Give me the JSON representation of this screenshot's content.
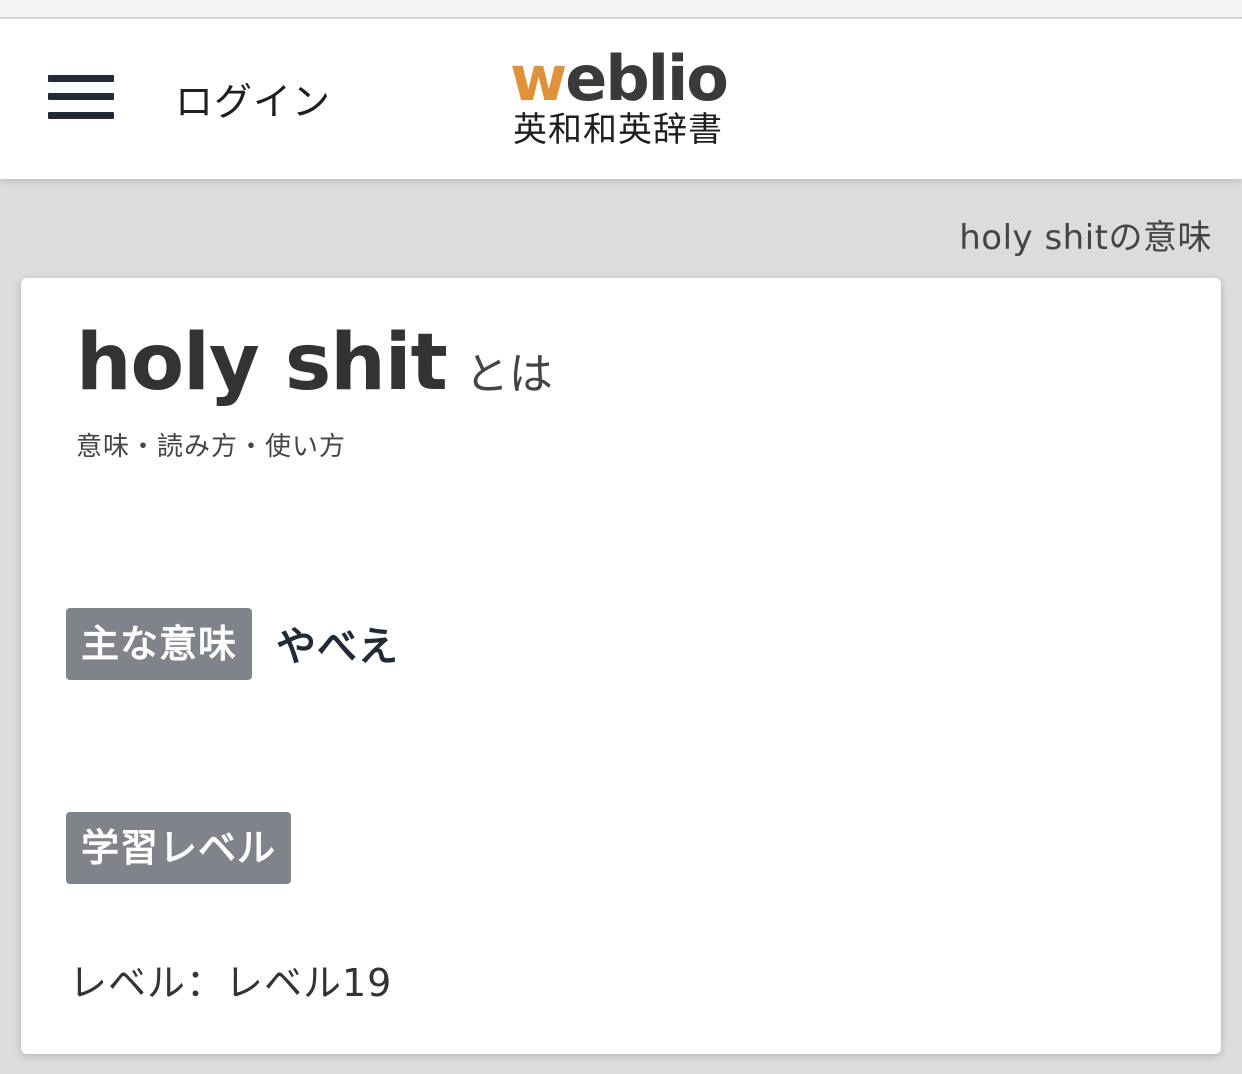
{
  "header": {
    "menu_icon": "hamburger-menu-icon",
    "login_label": "ログイン",
    "logo": {
      "word_first": "w",
      "word_rest": "eblio",
      "subtitle": "英和和英辞書",
      "accent_color": "#e0923a"
    }
  },
  "breadcrumb": "holy shitの意味",
  "entry": {
    "headword": "holy shit",
    "headword_suffix": "とは",
    "subtitle": "意味・読み方・使い方",
    "main_meaning_label": "主な意味",
    "main_meaning": "やべえ",
    "level_section_label": "学習レベル",
    "level_text": "レベル：レベル19"
  }
}
